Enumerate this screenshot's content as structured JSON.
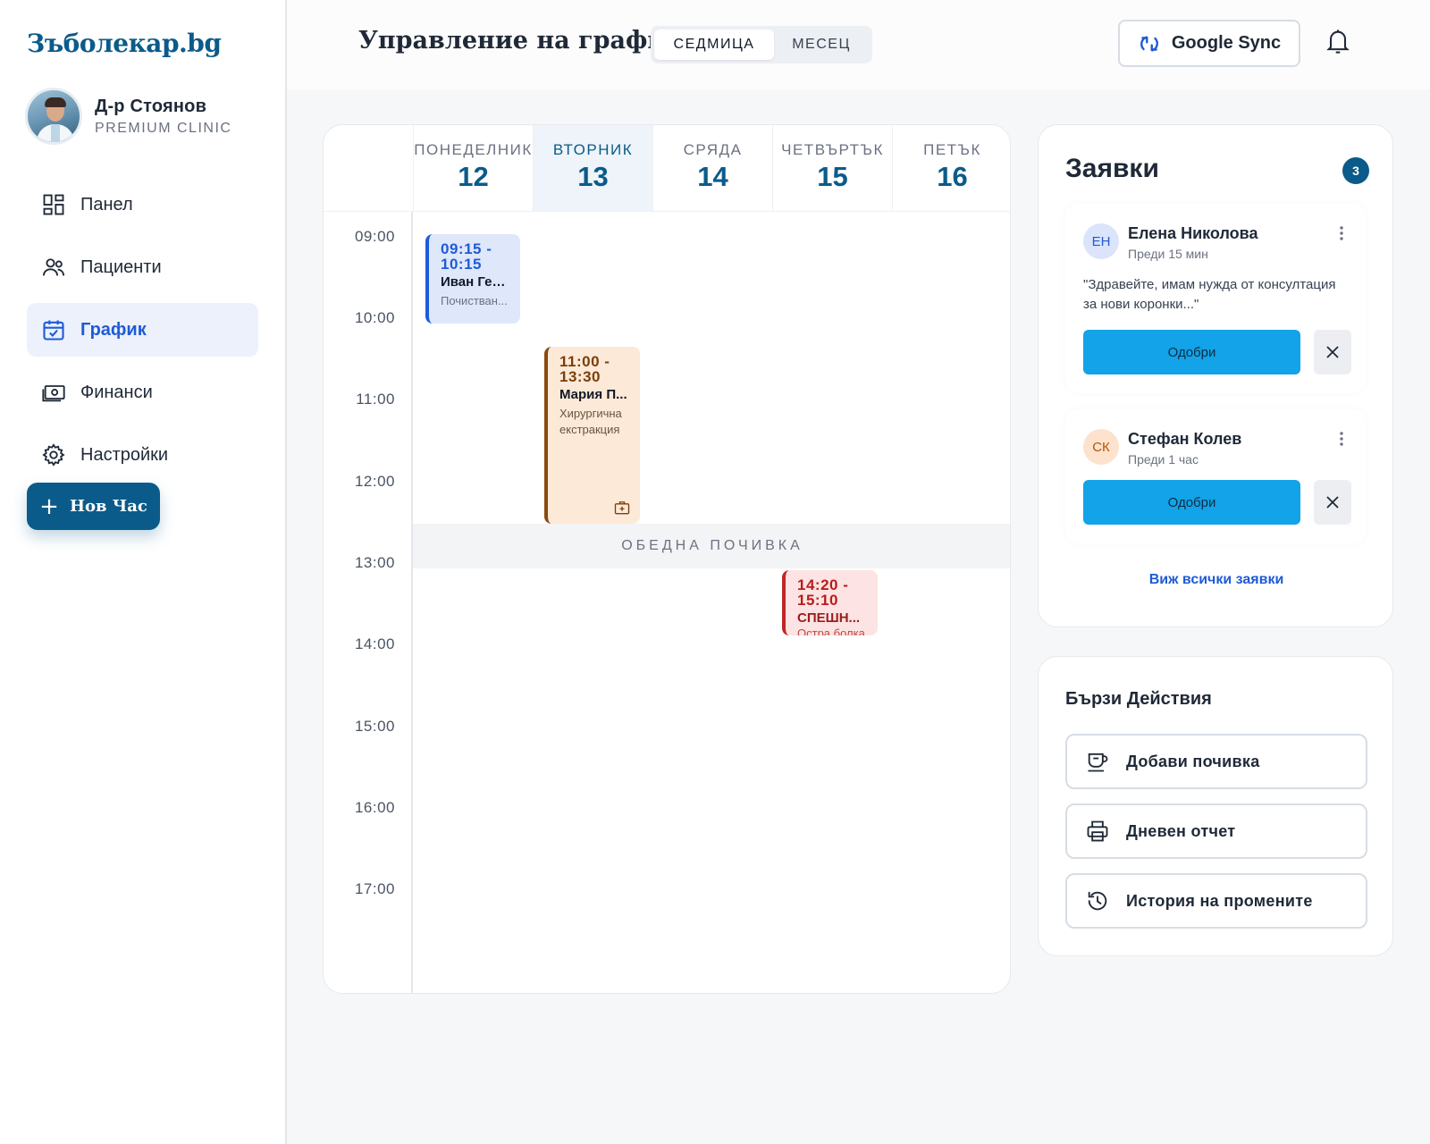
{
  "brand": {
    "logo": "Зъболекар.bg"
  },
  "profile": {
    "name": "Д-р Стоянов",
    "subtitle": "PREMIUM CLINIC"
  },
  "nav": {
    "items": [
      {
        "label": "Панел",
        "icon": "dashboard-icon"
      },
      {
        "label": "Пациенти",
        "icon": "users-icon"
      },
      {
        "label": "График",
        "icon": "calendar-check-icon",
        "active": true
      },
      {
        "label": "Финанси",
        "icon": "money-icon"
      },
      {
        "label": "Настройки",
        "icon": "gear-icon"
      }
    ],
    "new_button": {
      "plus": "+",
      "label": "Нов Час"
    }
  },
  "header": {
    "title": "Управление на график",
    "view_toggle": {
      "week": "СЕДМИЦА",
      "month": "МЕСЕЦ",
      "selected": "week"
    },
    "sync_label": "Google Sync"
  },
  "calendar": {
    "days": [
      {
        "name": "ПОНЕДЕЛНИК",
        "num": "12"
      },
      {
        "name": "ВТОРНИК",
        "num": "13",
        "today": true
      },
      {
        "name": "СРЯДА",
        "num": "14"
      },
      {
        "name": "ЧЕТВЪРТЪК",
        "num": "15"
      },
      {
        "name": "ПЕТЪК",
        "num": "16"
      }
    ],
    "hours": [
      "09:00",
      "10:00",
      "11:00",
      "12:00",
      "13:00",
      "14:00",
      "15:00",
      "16:00",
      "17:00"
    ],
    "lunch_label": "ОБЕДНА ПОЧИВКА",
    "appointments": [
      {
        "time": "09:15 - 10:15",
        "name": "Иван Гео...",
        "desc": "Почистван...",
        "color": "#1e5bd7"
      },
      {
        "time": "11:00 - 13:30",
        "name": "Мария П...",
        "desc": "Хирургична екстракция",
        "color": "#8a4a0e"
      },
      {
        "time": "14:20 - 15:10",
        "name": "СПЕШН...",
        "desc": "Остра болка",
        "color": "#c02626"
      }
    ]
  },
  "requests": {
    "title": "Заявки",
    "count": "3",
    "items": [
      {
        "initials": "ЕН",
        "name": "Елена Николова",
        "time": "Преди 15 мин",
        "quote": "\"Здравейте, имам нужда от консултация за нови коронки...\"",
        "approve": "Одобри"
      },
      {
        "initials": "СК",
        "name": "Стефан Колев",
        "time": "Преди 1 час",
        "approve": "Одобри"
      }
    ],
    "view_all": "Виж всички заявки"
  },
  "quick_actions": {
    "title": "Бързи Действия",
    "items": [
      {
        "label": "Добави почивка",
        "icon": "coffee-cup-icon"
      },
      {
        "label": "Дневен отчет",
        "icon": "printer-icon"
      },
      {
        "label": "История на промените",
        "icon": "history-icon"
      }
    ]
  },
  "colors": {
    "primary": "#0b5b8a",
    "accent": "#1e5bd7",
    "approve": "#12a3e8"
  }
}
